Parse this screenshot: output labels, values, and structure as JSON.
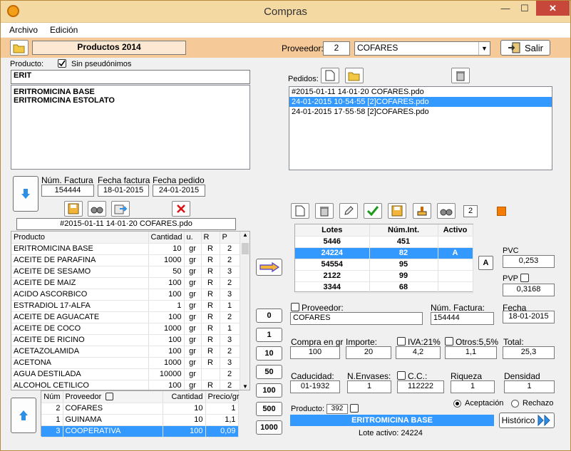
{
  "window": {
    "title": "Compras",
    "min": "—",
    "max": "☐",
    "close": "✕"
  },
  "menu": [
    "Archivo",
    "Edición"
  ],
  "toolbar": {
    "product_list": "Productos 2014",
    "proveedor_label": "Proveedor:",
    "proveedor_id": "2",
    "proveedor_name": "COFARES",
    "salir": "Salir"
  },
  "producto": {
    "label": "Producto:",
    "sin_pseudo": "Sin pseudónimos",
    "search": "ERIT",
    "results": [
      "ERITROMICINA BASE",
      "ERITROMICINA ESTOLATO"
    ]
  },
  "factura": {
    "num_label": "Núm. Factura",
    "num": "154444",
    "fecha_label": "Fecha factura",
    "fecha": "18-01-2015",
    "pedido_label": "Fecha pedido",
    "pedido": "24-01-2015",
    "file": "#2015-01-11 14·01·20 COFARES.pdo"
  },
  "products_table": {
    "headers": [
      "Producto",
      "Cantidad",
      "u.",
      "R",
      "P"
    ],
    "rows": [
      [
        "ERITROMICINA BASE",
        "10",
        "gr",
        "R",
        "2"
      ],
      [
        "ACEITE DE PARAFINA",
        "1000",
        "gr",
        "R",
        "2"
      ],
      [
        "ACEITE DE SESAMO",
        "50",
        "gr",
        "R",
        "3"
      ],
      [
        "ACEITE DE MAIZ",
        "100",
        "gr",
        "R",
        "2"
      ],
      [
        "ACIDO ASCORBICO",
        "100",
        "gr",
        "R",
        "3"
      ],
      [
        "ESTRADIOL 17-ALFA",
        "1",
        "gr",
        "R",
        "1"
      ],
      [
        "ACEITE DE AGUACATE",
        "100",
        "gr",
        "R",
        "2"
      ],
      [
        "ACEITE DE COCO",
        "1000",
        "gr",
        "R",
        "1"
      ],
      [
        "ACEITE DE RICINO",
        "100",
        "gr",
        "R",
        "3"
      ],
      [
        "ACETAZOLAMIDA",
        "100",
        "gr",
        "R",
        "2"
      ],
      [
        "ACETONA",
        "1000",
        "gr",
        "R",
        "3"
      ],
      [
        "AGUA DESTILADA",
        "10000",
        "gr",
        "",
        "2"
      ],
      [
        "ALCOHOL CETILICO",
        "100",
        "gr",
        "R",
        "2"
      ]
    ]
  },
  "suppliers_table": {
    "headers": [
      "Núm",
      "Proveedor",
      "Cantidad",
      "Precio/gr"
    ],
    "rows": [
      [
        "2",
        "COFARES",
        "10",
        "1"
      ],
      [
        "1",
        "GUINAMA",
        "10",
        "1,1"
      ],
      [
        "3",
        "COOPERATIVA",
        "100",
        "0,09"
      ]
    ]
  },
  "quantity_buttons": [
    "0",
    "1",
    "10",
    "50",
    "100",
    "500",
    "1000"
  ],
  "pedidos": {
    "label": "Pedidos:",
    "items": [
      "#2015-01-11 14·01·20 COFARES.pdo",
      "24-01-2015 10·54·55 [2]COFARES.pdo",
      "24-01-2015 17·55·58 [2]COFARES.pdo"
    ]
  },
  "lote_count": "2",
  "lotes_table": {
    "headers": [
      "Lotes",
      "Núm.Int.",
      "Activo"
    ],
    "rows": [
      [
        "5446",
        "451",
        ""
      ],
      [
        "24224",
        "82",
        "A"
      ],
      [
        "54554",
        "95",
        ""
      ],
      [
        "2122",
        "99",
        ""
      ],
      [
        "3344",
        "68",
        ""
      ]
    ]
  },
  "a_button": "A",
  "prices": {
    "pvc_label": "PVC",
    "pvc": "0,253",
    "pvp_label": "PVP",
    "pvp": "0,3168"
  },
  "details": {
    "proveedor_label": "Proveedor:",
    "proveedor": "COFARES",
    "factura_label": "Núm. Factura:",
    "factura": "154444",
    "fecha_label": "Fecha",
    "fecha": "18-01-2015",
    "compra_label": "Compra en gr",
    "compra": "100",
    "importe_label": "Importe:",
    "importe": "20",
    "iva_label": "IVA:21%",
    "iva": "4,2",
    "otros_label": "Otros:5,5%",
    "otros": "1,1",
    "total_label": "Total:",
    "total": "25,3",
    "caducidad_label": "Caducidad:",
    "caducidad": "01-1932",
    "envases_label": "N.Envases:",
    "envases": "1",
    "cc_label": "C.C.:",
    "cc": "112222",
    "riqueza_label": "Riqueza",
    "riqueza": "1",
    "densidad_label": "Densidad",
    "densidad": "1"
  },
  "bottom": {
    "producto_label": "Producto:",
    "producto_id": "392",
    "producto_name": "ERITROMICINA BASE",
    "lote_activo": "Lote activo: 24224",
    "aceptacion": "Aceptación",
    "rechazo": "Rechazo",
    "historico": "Histórico"
  },
  "colors": {
    "selection": "#3399ff",
    "toolbar": "#f6c998",
    "title": "#f4d9a3",
    "close": "#c7483b",
    "orange": "#f57c00"
  }
}
